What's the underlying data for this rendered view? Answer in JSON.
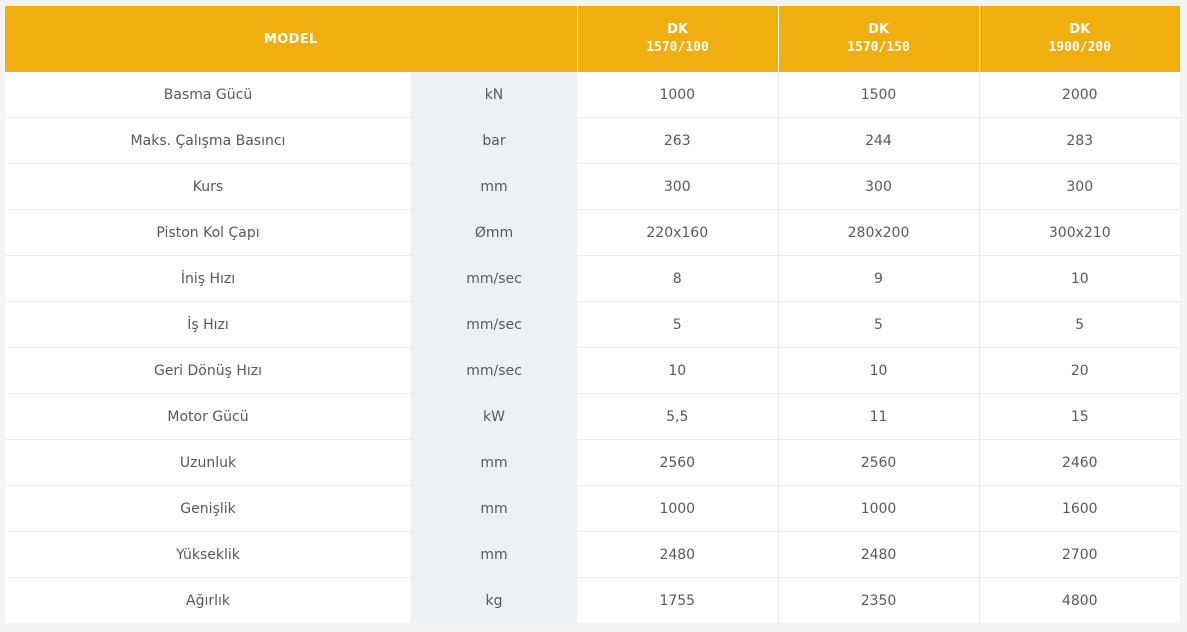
{
  "header": {
    "model_label": "MODEL",
    "models": [
      {
        "line1": "DK",
        "line2": "1570/100"
      },
      {
        "line1": "DK",
        "line2": "1570/150"
      },
      {
        "line1": "DK",
        "line2": "1900/200"
      }
    ]
  },
  "rows": [
    {
      "label": "Basma Gücü",
      "unit": "kN",
      "values": [
        "1000",
        "1500",
        "2000"
      ]
    },
    {
      "label": "Maks. Çalışma Basıncı",
      "unit": "bar",
      "values": [
        "263",
        "244",
        "283"
      ]
    },
    {
      "label": "Kurs",
      "unit": "mm",
      "values": [
        "300",
        "300",
        "300"
      ]
    },
    {
      "label": "Piston Kol Çapı",
      "unit": "Ømm",
      "values": [
        "220x160",
        "280x200",
        "300x210"
      ]
    },
    {
      "label": "İniş Hızı",
      "unit": "mm/sec",
      "values": [
        "8",
        "9",
        "10"
      ]
    },
    {
      "label": "İş Hızı",
      "unit": "mm/sec",
      "values": [
        "5",
        "5",
        "5"
      ]
    },
    {
      "label": "Geri Dönüş Hızı",
      "unit": "mm/sec",
      "values": [
        "10",
        "10",
        "20"
      ]
    },
    {
      "label": "Motor Gücü",
      "unit": "kW",
      "values": [
        "5,5",
        "11",
        "15"
      ]
    },
    {
      "label": "Uzunluk",
      "unit": "mm",
      "values": [
        "2560",
        "2560",
        "2460"
      ]
    },
    {
      "label": "Genişlik",
      "unit": "mm",
      "values": [
        "1000",
        "1000",
        "1600"
      ]
    },
    {
      "label": "Yükseklik",
      "unit": "mm",
      "values": [
        "2480",
        "2480",
        "2700"
      ]
    },
    {
      "label": "Ağırlık",
      "unit": "kg",
      "values": [
        "1755",
        "2350",
        "4800"
      ]
    }
  ],
  "colors": {
    "header_bg": "#f0ae0f",
    "header_text": "#ffffff",
    "unit_column_bg": "#eef1f4",
    "body_text": "#555a5e"
  }
}
